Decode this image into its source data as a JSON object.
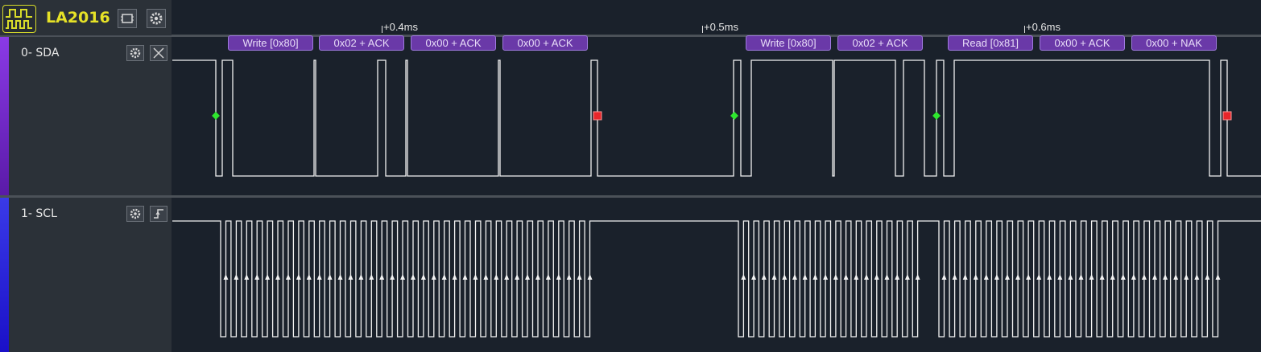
{
  "header": {
    "device_name": "LA2016",
    "logo_icon": "logic-analyzer-logo-icon",
    "buttons": [
      {
        "name": "device-info-button",
        "icon": "chip-icon"
      },
      {
        "name": "device-settings-button",
        "icon": "gear-icon"
      }
    ]
  },
  "channels": [
    {
      "label": "0- SDA",
      "stripe_color": "#7a2ad8",
      "buttons": [
        {
          "icon": "gear-icon"
        },
        {
          "icon": "close-icon"
        }
      ]
    },
    {
      "label": "1- SCL",
      "stripe_color": "#2a1ae6",
      "buttons": [
        {
          "icon": "gear-icon"
        },
        {
          "icon": "rising-edge-trigger-icon"
        }
      ]
    }
  ],
  "time_markers": [
    "+0.4ms",
    "+0.5ms",
    "+0.6ms"
  ],
  "decodes": [
    "Write [0x80]",
    "0x02 + ACK",
    "0x00 + ACK",
    "0x00 + ACK",
    "Write [0x80]",
    "0x02 + ACK",
    "Read [0x81]",
    "0x00 + ACK",
    "0x00 + NAK"
  ],
  "colors": {
    "background": "#1a212b",
    "waveform": "#f2f2f2",
    "decode_fill": "#6a39a8",
    "start_marker": "#2ee62e",
    "stop_marker": "#e8262a",
    "device_name": "#e6e227"
  }
}
